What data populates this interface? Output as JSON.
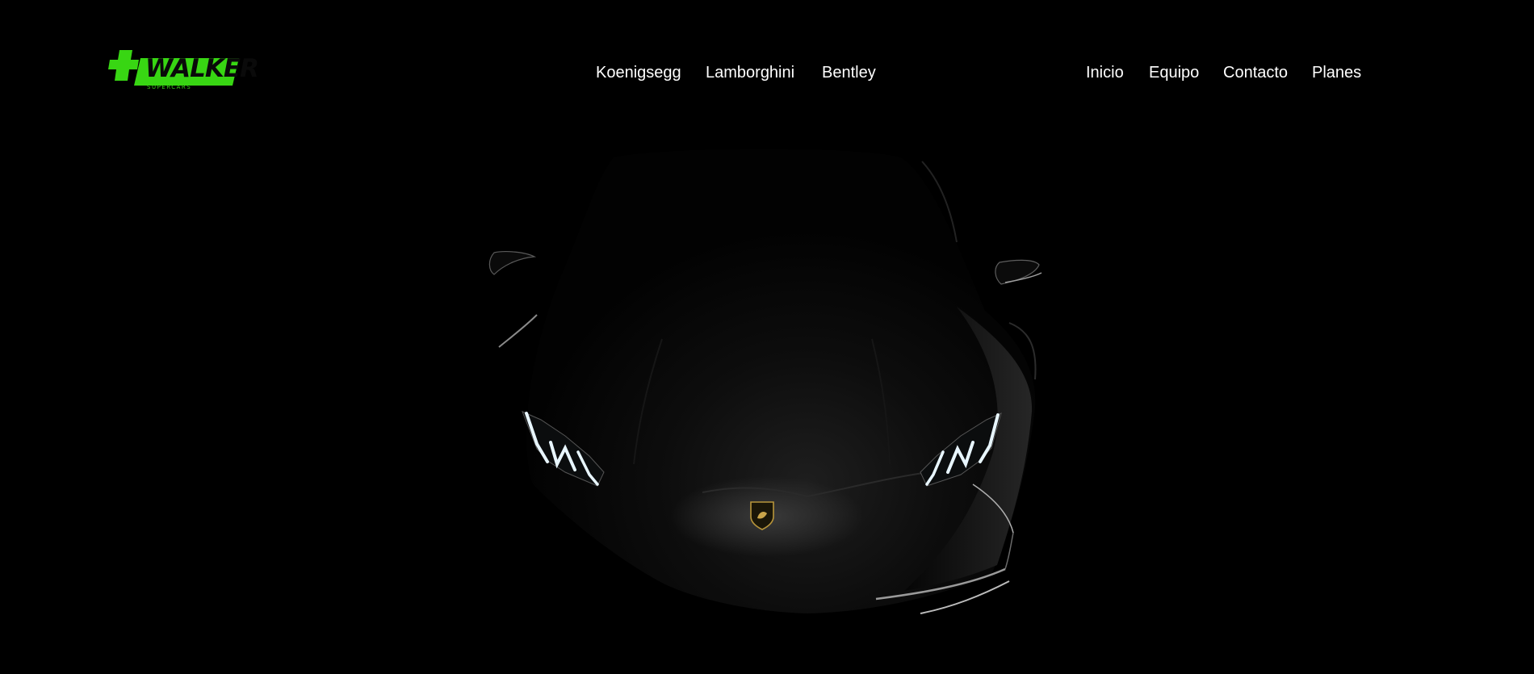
{
  "logo": {
    "word": "WALKER",
    "subtitle": "SUPERCARS"
  },
  "nav_brands": [
    {
      "label": "Koenigsegg"
    },
    {
      "label": "Lamborghini"
    },
    {
      "label": "Bentley"
    }
  ],
  "nav_main": [
    {
      "label": "Inicio"
    },
    {
      "label": "Equipo"
    },
    {
      "label": "Contacto"
    },
    {
      "label": "Planes"
    }
  ],
  "colors": {
    "background": "#000000",
    "brand_green": "#38d613",
    "nav_text": "#ffffff",
    "headlight": "#e8f6ff"
  },
  "hero": {
    "subject": "lamborghini-huracan-front-silhouette"
  }
}
